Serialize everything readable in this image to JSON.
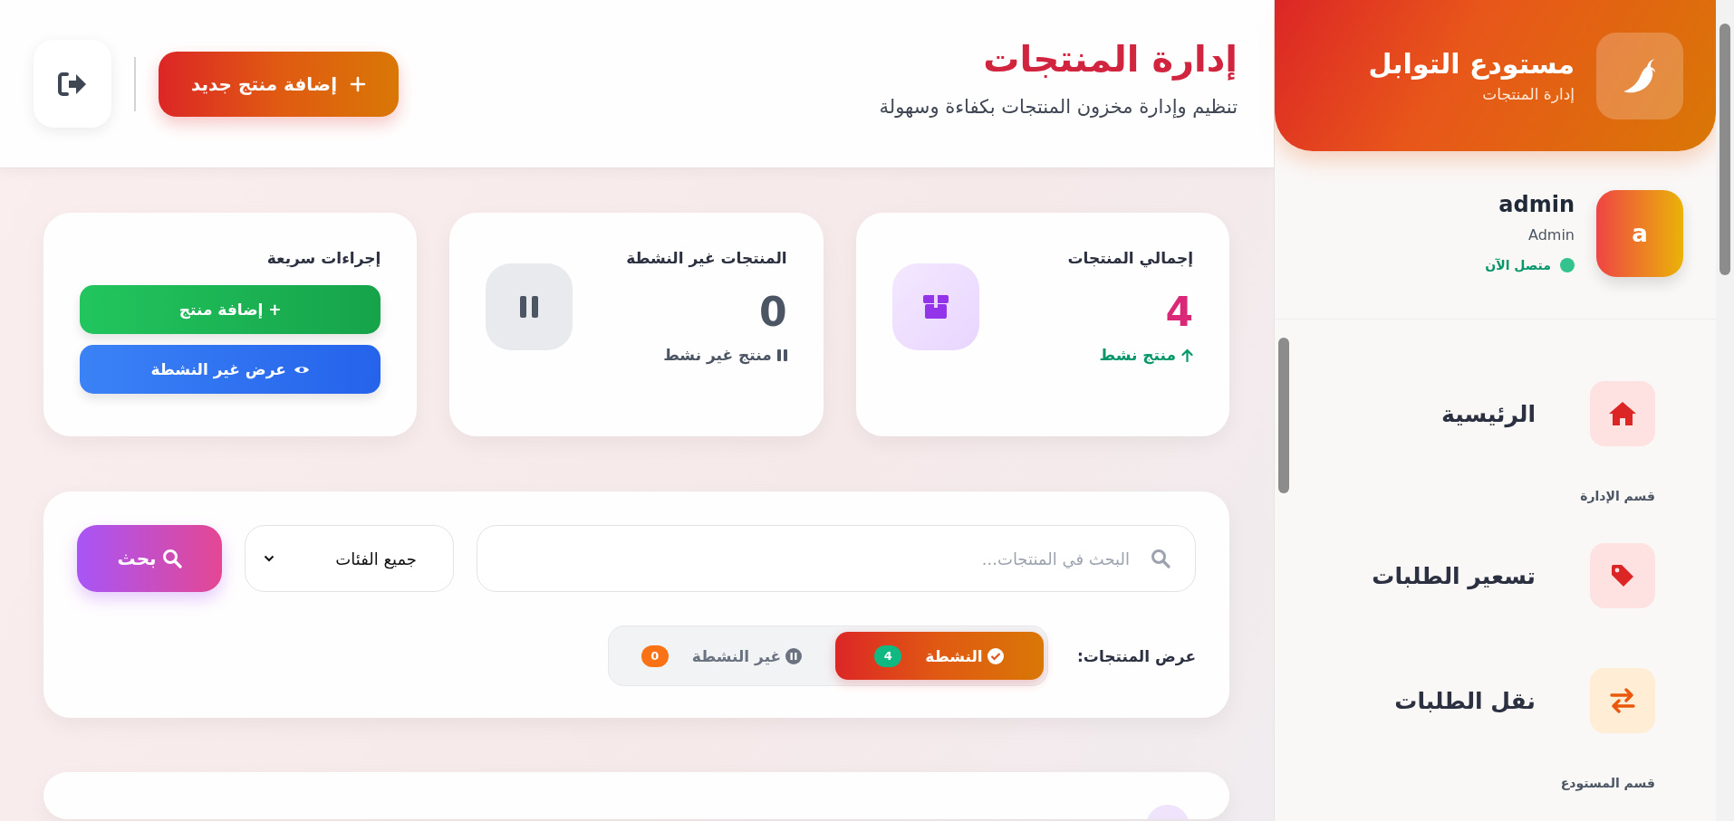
{
  "header": {
    "title": "إدارة المنتجات",
    "subtitle": "تنظيم وإدارة مخزون المنتجات بكفاءة وسهولة",
    "add_button": "إضافة منتج جديد"
  },
  "stats": [
    {
      "kind": "total",
      "title": "إجمالي المنتجات",
      "value": "4",
      "note": "منتج نشط"
    },
    {
      "kind": "inactive",
      "title": "المنتجات غير النشطة",
      "value": "0",
      "note": "منتج غير نشط"
    },
    {
      "kind": "actions",
      "title": "إجراءات سريعة",
      "buttons": [
        {
          "kind": "add",
          "label": "+ إضافة منتج"
        },
        {
          "kind": "view",
          "label": "عرض غير النشطة"
        }
      ]
    }
  ],
  "search": {
    "placeholder": "البحث في المنتجات...",
    "category": "جميع الفئات",
    "button": "بحث"
  },
  "filter": {
    "label": "عرض المنتجات:",
    "options": [
      {
        "kind": "active",
        "label": "النشطة",
        "count": "4",
        "selected": true
      },
      {
        "kind": "inactive",
        "label": "غير النشطة",
        "count": "0",
        "selected": false
      }
    ]
  },
  "sidebar": {
    "brand": "مستودع التوابل",
    "brand_subtitle": "إدارة المنتجات",
    "user": {
      "name": "admin",
      "role": "Admin",
      "avatar": "a",
      "status": "متصل الآن"
    },
    "items": [
      {
        "kind": "link",
        "label": "الرئيسية"
      },
      {
        "kind": "section",
        "label": "قسم الإدارة"
      },
      {
        "kind": "link",
        "label": "تسعير الطلبات"
      },
      {
        "kind": "link",
        "label": "نقل الطلبات"
      },
      {
        "kind": "section",
        "label": "قسم المستودع"
      }
    ]
  }
}
